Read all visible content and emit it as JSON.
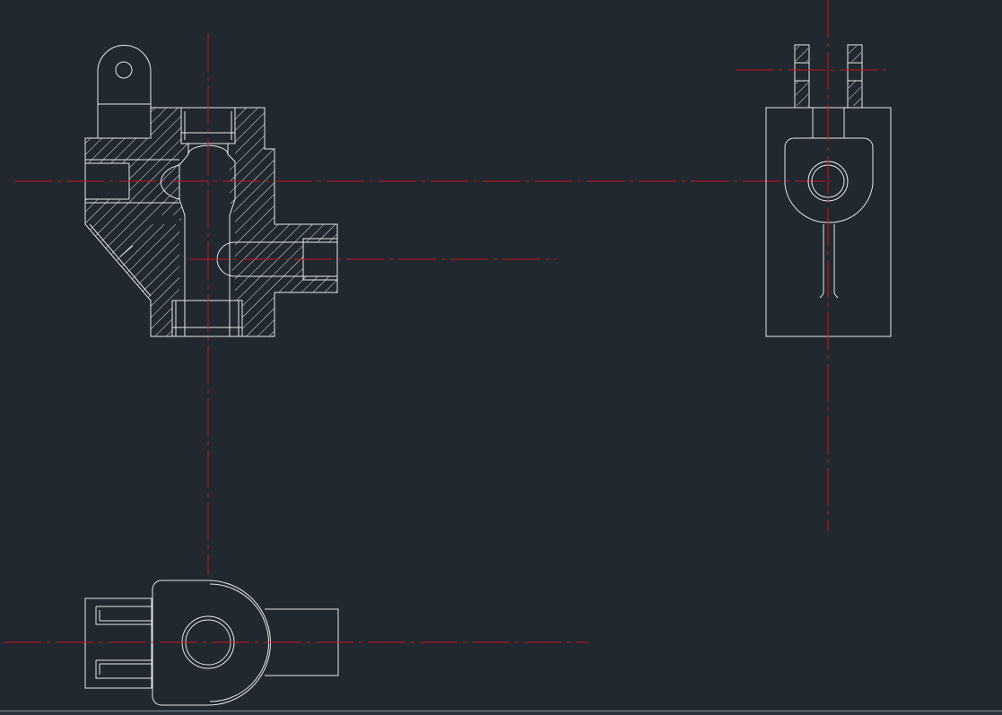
{
  "app": {
    "title": ""
  },
  "drawing": {
    "background": "#212830",
    "geometry_color": "#e8e8e8",
    "centerline_color": "#d01020",
    "views": [
      {
        "id": "front-section",
        "kind": "sectioned front view"
      },
      {
        "id": "side-view",
        "kind": "side view"
      },
      {
        "id": "top-view",
        "kind": "top view"
      }
    ]
  }
}
